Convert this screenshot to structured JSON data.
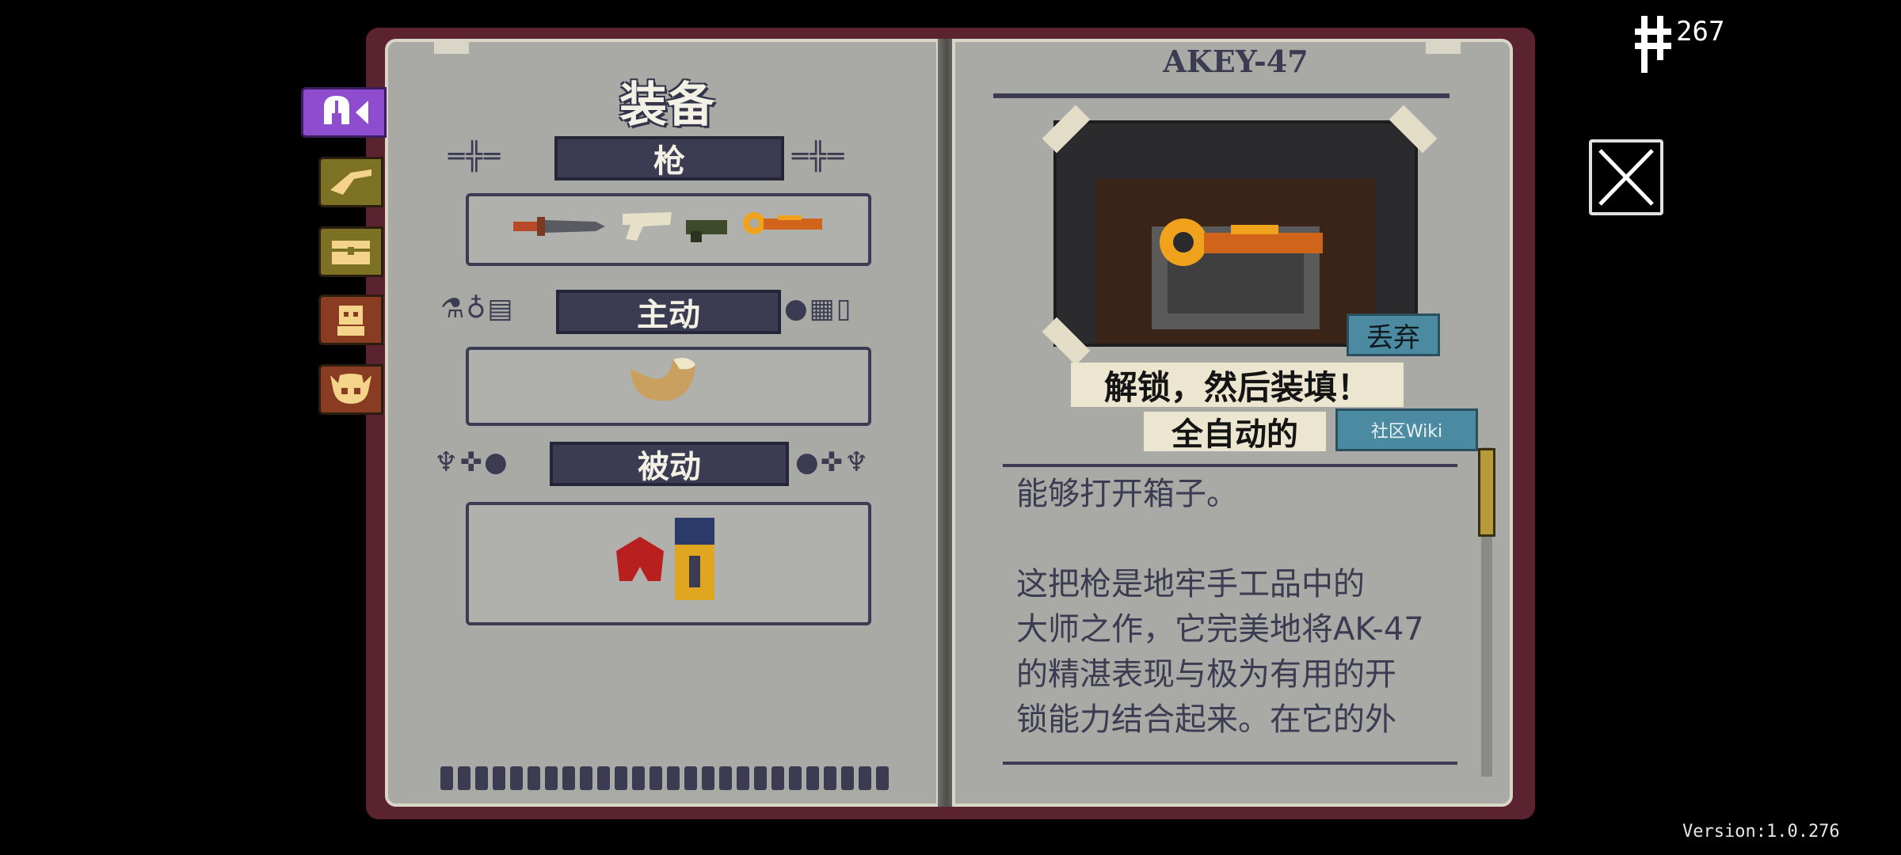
{
  "hud": {
    "currency_value": "267",
    "currency_icon": "hegemony-credit-icon",
    "close_icon": "close-icon",
    "version": "Version:1.0.276"
  },
  "tabs": [
    {
      "name": "equipment",
      "icon": "helmet-icon",
      "active": true
    },
    {
      "name": "guns",
      "icon": "gun-icon"
    },
    {
      "name": "items",
      "icon": "chest-icon"
    },
    {
      "name": "npcs",
      "icon": "npc-icon"
    },
    {
      "name": "bosses",
      "icon": "skull-icon"
    }
  ],
  "left_page": {
    "title": "装备",
    "guns_label": "枪",
    "active_label": "主动",
    "passive_label": "被动"
  },
  "right_page": {
    "weapon_name": "AKEY-47",
    "drop_button": "丢弃",
    "quote": "解锁，然后装填！",
    "type_tag": "全自动的",
    "wiki_button": "社区Wiki",
    "description": "能够打开箱子。\n\n这把枪是地牢手工品中的\n大师之作，它完美地将AK-47\n的精湛表现与极为有用的开\n锁能力结合起来。在它的外"
  },
  "colors": {
    "book_border": "#5b2330",
    "page": "#a9a9a5",
    "ink": "#3b3b52",
    "tab_active": "#8e4ccf",
    "wiki_blue": "#4b8aa0"
  }
}
